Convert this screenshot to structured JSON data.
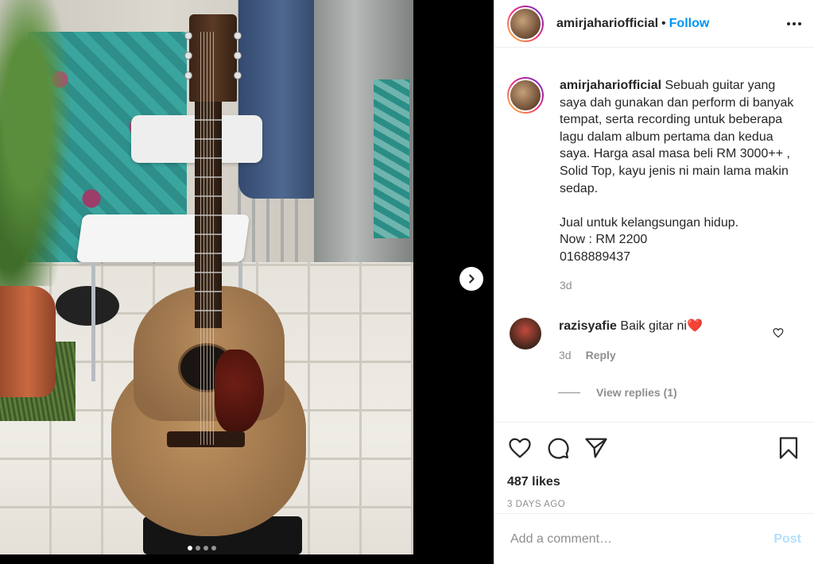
{
  "post": {
    "author": "amirjahariofficial",
    "follow_label": "Follow",
    "separator": "•",
    "carousel": {
      "total_slides": 4,
      "active_index": 0
    }
  },
  "caption": {
    "username": "amirjahariofficial",
    "text": "Sebuah guitar yang saya dah gunakan dan perform di banyak tempat, serta recording untuk beberapa lagu dalam album pertama dan kedua saya. Harga asal masa beli RM 3000++ , Solid Top, kayu jenis ni main lama makin sedap.\n\nJual untuk kelangsungan hidup.\nNow : RM 2200\n0168889437",
    "time": "3d"
  },
  "comments": [
    {
      "username": "razisyafie",
      "text": "Baik gitar ni❤️",
      "time": "3d",
      "reply_label": "Reply",
      "view_replies_label": "View replies (1)"
    }
  ],
  "engagement": {
    "likes": "487 likes",
    "date": "3 DAYS AGO"
  },
  "comment_box": {
    "placeholder": "Add a comment…",
    "post_label": "Post"
  },
  "icons": {
    "more": "more-options-icon",
    "like": "heart-icon",
    "comment": "comment-icon",
    "share": "paper-plane-icon",
    "save": "bookmark-icon",
    "next": "chevron-right-icon"
  },
  "colors": {
    "link_blue": "#0095f6",
    "post_disabled": "#b2dffc",
    "secondary_text": "#8e8e8e",
    "text": "#262626"
  }
}
